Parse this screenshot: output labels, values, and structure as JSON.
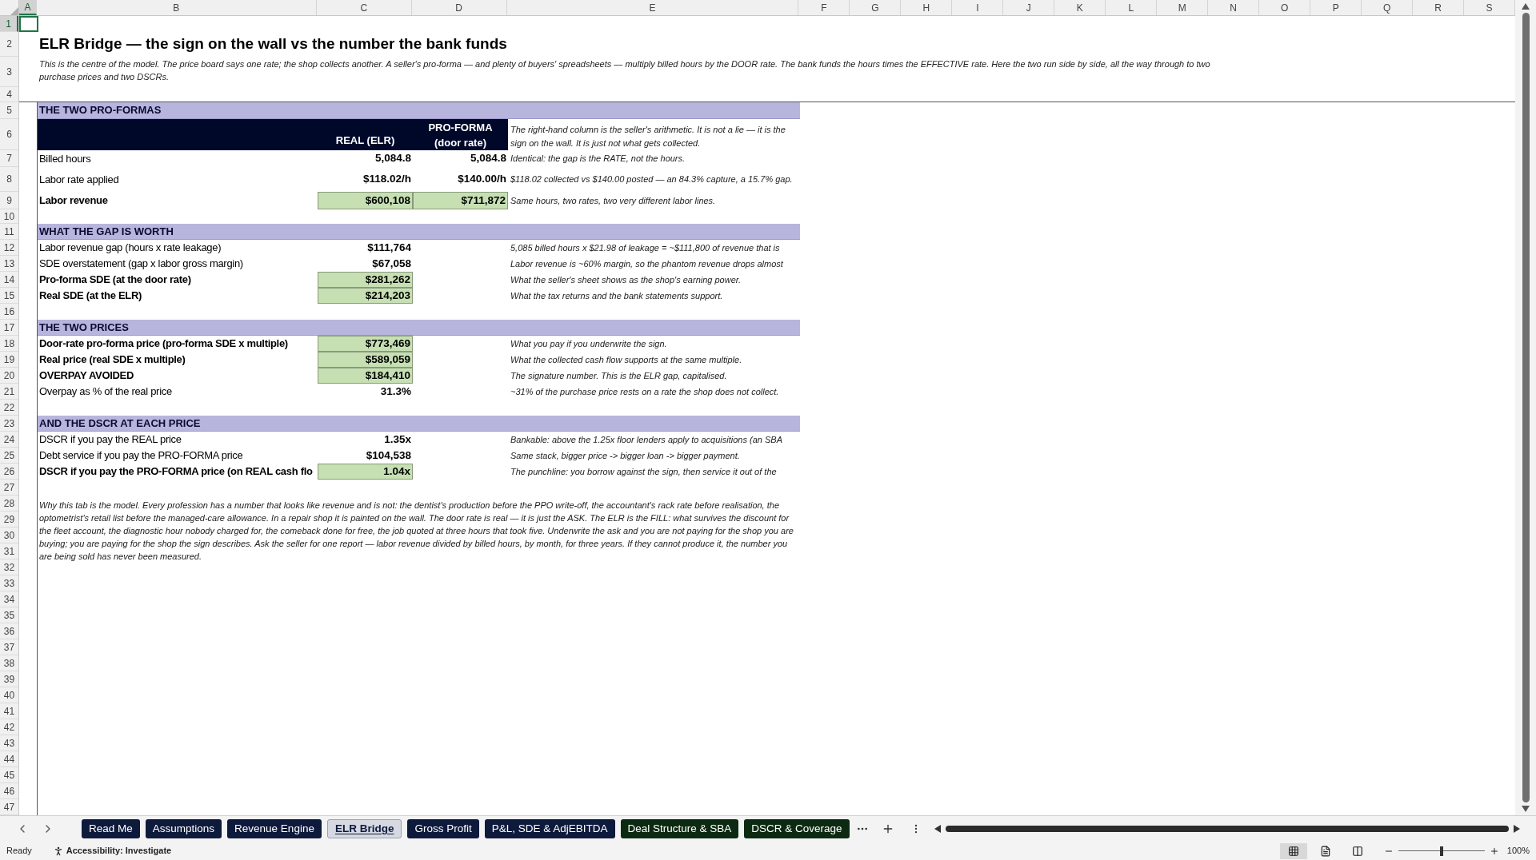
{
  "columns": [
    {
      "label": "A",
      "selected": true
    },
    {
      "label": "B",
      "selected": false
    },
    {
      "label": "C",
      "selected": false
    },
    {
      "label": "D",
      "selected": false
    },
    {
      "label": "E",
      "selected": false
    },
    {
      "label": "F",
      "selected": false
    },
    {
      "label": "G",
      "selected": false
    },
    {
      "label": "H",
      "selected": false
    },
    {
      "label": "I",
      "selected": false
    },
    {
      "label": "J",
      "selected": false
    },
    {
      "label": "K",
      "selected": false
    },
    {
      "label": "L",
      "selected": false
    },
    {
      "label": "M",
      "selected": false
    },
    {
      "label": "N",
      "selected": false
    },
    {
      "label": "O",
      "selected": false
    },
    {
      "label": "P",
      "selected": false
    },
    {
      "label": "Q",
      "selected": false
    },
    {
      "label": "R",
      "selected": false
    },
    {
      "label": "S",
      "selected": false
    }
  ],
  "row_numbers": [
    {
      "label": "1",
      "selected": true
    },
    {
      "label": "2",
      "selected": false
    },
    {
      "label": "3",
      "selected": false
    },
    {
      "label": "4",
      "selected": false
    },
    {
      "label": "5",
      "selected": false
    },
    {
      "label": "6",
      "selected": false
    },
    {
      "label": "7",
      "selected": false
    },
    {
      "label": "8",
      "selected": false
    },
    {
      "label": "9",
      "selected": false
    },
    {
      "label": "10",
      "selected": false
    },
    {
      "label": "11",
      "selected": false
    },
    {
      "label": "12",
      "selected": false
    },
    {
      "label": "13",
      "selected": false
    },
    {
      "label": "14",
      "selected": false
    },
    {
      "label": "15",
      "selected": false
    },
    {
      "label": "16",
      "selected": false
    },
    {
      "label": "17",
      "selected": false
    },
    {
      "label": "18",
      "selected": false
    },
    {
      "label": "19",
      "selected": false
    },
    {
      "label": "20",
      "selected": false
    },
    {
      "label": "21",
      "selected": false
    },
    {
      "label": "22",
      "selected": false
    },
    {
      "label": "23",
      "selected": false
    },
    {
      "label": "24",
      "selected": false
    },
    {
      "label": "25",
      "selected": false
    },
    {
      "label": "26",
      "selected": false
    },
    {
      "label": "27",
      "selected": false
    },
    {
      "label": "28",
      "selected": false
    },
    {
      "label": "29",
      "selected": false
    },
    {
      "label": "30",
      "selected": false
    },
    {
      "label": "31",
      "selected": false
    },
    {
      "label": "32",
      "selected": false
    },
    {
      "label": "33",
      "selected": false
    },
    {
      "label": "34",
      "selected": false
    },
    {
      "label": "35",
      "selected": false
    },
    {
      "label": "36",
      "selected": false
    },
    {
      "label": "37",
      "selected": false
    },
    {
      "label": "38",
      "selected": false
    },
    {
      "label": "39",
      "selected": false
    },
    {
      "label": "40",
      "selected": false
    },
    {
      "label": "41",
      "selected": false
    },
    {
      "label": "42",
      "selected": false
    },
    {
      "label": "43",
      "selected": false
    },
    {
      "label": "44",
      "selected": false
    },
    {
      "label": "45",
      "selected": false
    },
    {
      "label": "46",
      "selected": false
    },
    {
      "label": "47",
      "selected": false
    }
  ],
  "title": "ELR Bridge — the sign on the wall vs the number the bank funds",
  "intro": "This is the centre of the model. The price board says one rate; the shop collects another. A seller's pro-forma — and plenty of buyers' spreadsheets — multiply billed hours by the DOOR rate. The bank funds the hours times the EFFECTIVE rate. Here the two run side by side, all the way through to two purchase prices and two DSCRs.",
  "sections": [
    {
      "title": "THE TWO PRO-FORMAS",
      "rows": [
        {
          "kind": "header",
          "real": "REAL (ELR)",
          "proforma": "PRO-FORMA (door rate)",
          "note": "The right-hand column is the seller's arithmetic. It is not a lie — it is the sign on the wall. It is just not what gets collected."
        },
        {
          "kind": "data",
          "label": "Billed hours",
          "bold": false,
          "real": "5,084.8",
          "proforma": "5,084.8",
          "highlight": false,
          "note": "Identical: the gap is the RATE, not the hours."
        },
        {
          "kind": "data",
          "label": "Labor rate applied",
          "bold": false,
          "real": "$118.02/h",
          "proforma": "$140.00/h",
          "highlight": false,
          "note": "$118.02 collected vs $140.00 posted — an 84.3% capture, a 15.7% gap."
        },
        {
          "kind": "data",
          "label": "Labor revenue",
          "bold": true,
          "real": "$600,108",
          "proforma": "$711,872",
          "highlight": true,
          "note": "Same hours, two rates, two very different labor lines."
        }
      ]
    },
    {
      "title": "WHAT THE GAP IS WORTH",
      "rows": [
        {
          "kind": "data",
          "label": "Labor revenue gap (hours x rate leakage)",
          "bold": false,
          "real": "$111,764",
          "highlight": false,
          "note": "5,085 billed hours x $21.98 of leakage = ~$111,800 of revenue that is"
        },
        {
          "kind": "data",
          "label": "SDE overstatement (gap x labor gross margin)",
          "bold": false,
          "real": "$67,058",
          "highlight": false,
          "note": "Labor revenue is ~60% margin, so the phantom revenue drops almost"
        },
        {
          "kind": "data",
          "label": "Pro-forma SDE (at the door rate)",
          "bold": true,
          "real": "$281,262",
          "highlight": true,
          "note": "What the seller's sheet shows as the shop's earning power."
        },
        {
          "kind": "data",
          "label": "Real SDE (at the ELR)",
          "bold": true,
          "real": "$214,203",
          "highlight": true,
          "note": "What the tax returns and the bank statements support."
        }
      ]
    },
    {
      "title": "THE TWO PRICES",
      "rows": [
        {
          "kind": "data",
          "label": "Door-rate pro-forma price (pro-forma SDE x multiple)",
          "bold": true,
          "real": "$773,469",
          "highlight": true,
          "note": "What you pay if you underwrite the sign."
        },
        {
          "kind": "data",
          "label": "Real price (real SDE x multiple)",
          "bold": true,
          "real": "$589,059",
          "highlight": true,
          "note": "What the collected cash flow supports at the same multiple."
        },
        {
          "kind": "data",
          "label": "OVERPAY AVOIDED",
          "bold": true,
          "real": "$184,410",
          "highlight": true,
          "note": "The signature number. This is the ELR gap, capitalised."
        },
        {
          "kind": "data",
          "label": "Overpay as % of the real price",
          "bold": false,
          "real": "31.3%",
          "highlight": false,
          "note": "~31% of the purchase price rests on a rate the shop does not collect."
        }
      ]
    },
    {
      "title": "AND THE DSCR AT EACH PRICE",
      "rows": [
        {
          "kind": "data",
          "label": "DSCR if you pay the REAL price",
          "bold": false,
          "real": "1.35x",
          "highlight": false,
          "note": "Bankable: above the 1.25x floor lenders apply to acquisitions (an SBA"
        },
        {
          "kind": "data",
          "label": "Debt service if you pay the PRO-FORMA price",
          "bold": false,
          "real": "$104,538",
          "highlight": false,
          "note": "Same stack, bigger price -> bigger loan -> bigger payment."
        },
        {
          "kind": "data",
          "label": "DSCR if you pay the PRO-FORMA price (on REAL cash flo",
          "bold": true,
          "real": "1.04x",
          "highlight": true,
          "note": "The punchline: you borrow against the sign, then service it out of the"
        }
      ]
    }
  ],
  "closing_note": "Why this tab is the model. Every profession has a number that looks like revenue and is not: the dentist's production before the PPO write-off, the accountant's rack rate before realisation, the optometrist's retail list before the managed-care allowance. In a repair shop it is painted on the wall. The door rate is real — it is just the ASK. The ELR is the FILL: what survives the discount for the fleet account, the diagnostic hour nobody charged for, the comeback done for free, the job quoted at three hours that took five. Underwrite the ask and you are not paying for the shop you are buying; you are paying for the shop the sign describes. Ask the seller for one report — labor revenue divided by billed hours, by month, for three years. If they cannot produce it, the number you are being sold has never been measured.",
  "sheet_tabs": [
    {
      "label": "Read Me",
      "selected": false,
      "color": "#0e1a3c"
    },
    {
      "label": "Assumptions",
      "selected": false,
      "color": "#0e1a3c"
    },
    {
      "label": "Revenue Engine",
      "selected": false,
      "color": "#0e1a3c"
    },
    {
      "label": "ELR Bridge",
      "selected": true,
      "color": "#0e1a3c"
    },
    {
      "label": "Gross Profit",
      "selected": false,
      "color": "#0e1a3c"
    },
    {
      "label": "P&L, SDE & AdjEBITDA",
      "selected": false,
      "color": "#0e1a3c"
    },
    {
      "label": "Deal Structure & SBA",
      "selected": false,
      "color": "#0c2a12"
    },
    {
      "label": "DSCR & Coverage",
      "selected": false,
      "color": "#0c2a12"
    }
  ],
  "status_bar": {
    "ready": "Ready",
    "accessibility": "Accessibility: Investigate",
    "zoom": "100%",
    "zoom_slider": {
      "level": 0.5
    }
  }
}
